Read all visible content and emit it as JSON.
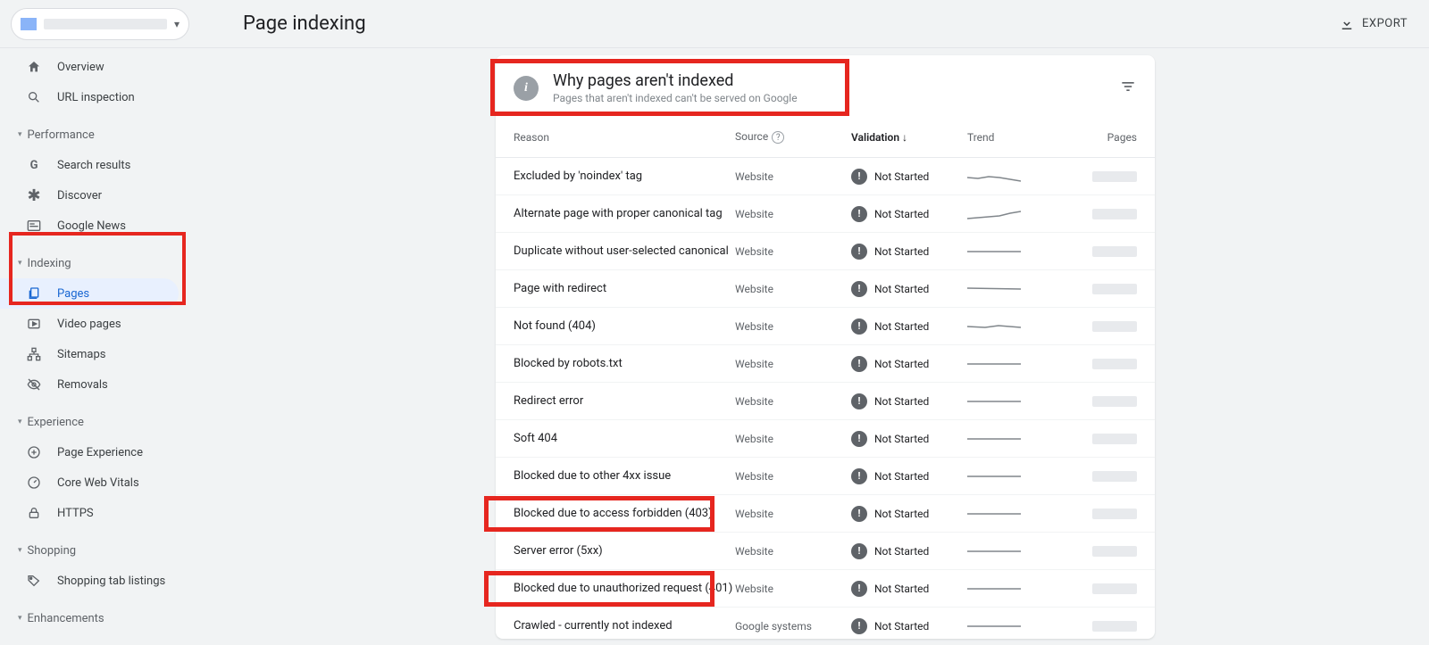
{
  "header": {
    "page_title": "Page indexing",
    "export_label": "EXPORT"
  },
  "sidebar": {
    "items_top": [
      {
        "icon": "home",
        "label": "Overview"
      },
      {
        "icon": "search",
        "label": "URL inspection"
      }
    ],
    "groups": [
      {
        "label": "Performance",
        "items": [
          {
            "icon": "g",
            "label": "Search results"
          },
          {
            "icon": "asterisk",
            "label": "Discover"
          },
          {
            "icon": "news",
            "label": "Google News"
          }
        ]
      },
      {
        "label": "Indexing",
        "items": [
          {
            "icon": "pages",
            "label": "Pages",
            "active": true
          },
          {
            "icon": "video",
            "label": "Video pages"
          },
          {
            "icon": "sitemap",
            "label": "Sitemaps"
          },
          {
            "icon": "eyeoff",
            "label": "Removals"
          }
        ]
      },
      {
        "label": "Experience",
        "items": [
          {
            "icon": "plus",
            "label": "Page Experience"
          },
          {
            "icon": "gauge",
            "label": "Core Web Vitals"
          },
          {
            "icon": "lock",
            "label": "HTTPS"
          }
        ]
      },
      {
        "label": "Shopping",
        "items": [
          {
            "icon": "tag",
            "label": "Shopping tab listings"
          }
        ]
      },
      {
        "label": "Enhancements",
        "items": []
      }
    ]
  },
  "card": {
    "title": "Why pages aren't indexed",
    "subtitle": "Pages that aren't indexed can't be served on Google",
    "columns": {
      "reason": "Reason",
      "source": "Source",
      "validation": "Validation",
      "trend": "Trend",
      "pages": "Pages"
    },
    "rows": [
      {
        "reason": "Excluded by 'noindex' tag",
        "source": "Website",
        "validation": "Not Started"
      },
      {
        "reason": "Alternate page with proper canonical tag",
        "source": "Website",
        "validation": "Not Started"
      },
      {
        "reason": "Duplicate without user-selected canonical",
        "source": "Website",
        "validation": "Not Started"
      },
      {
        "reason": "Page with redirect",
        "source": "Website",
        "validation": "Not Started"
      },
      {
        "reason": "Not found (404)",
        "source": "Website",
        "validation": "Not Started"
      },
      {
        "reason": "Blocked by robots.txt",
        "source": "Website",
        "validation": "Not Started"
      },
      {
        "reason": "Redirect error",
        "source": "Website",
        "validation": "Not Started"
      },
      {
        "reason": "Soft 404",
        "source": "Website",
        "validation": "Not Started"
      },
      {
        "reason": "Blocked due to other 4xx issue",
        "source": "Website",
        "validation": "Not Started"
      },
      {
        "reason": "Blocked due to access forbidden (403)",
        "source": "Website",
        "validation": "Not Started"
      },
      {
        "reason": "Server error (5xx)",
        "source": "Website",
        "validation": "Not Started"
      },
      {
        "reason": "Blocked due to unauthorized request (401)",
        "source": "Website",
        "validation": "Not Started"
      },
      {
        "reason": "Crawled - currently not indexed",
        "source": "Google systems",
        "validation": "Not Started"
      }
    ]
  }
}
